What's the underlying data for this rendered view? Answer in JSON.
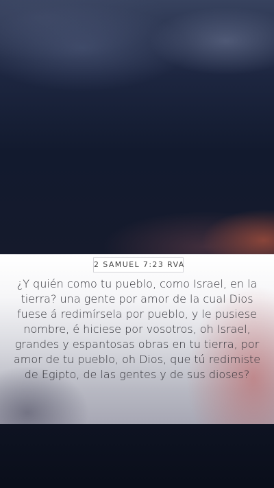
{
  "reference": "2 SAMUEL 7:23 RVA",
  "verse_text": "¿Y quién como tu pueblo, como Israel, en la tierra? una gente por amor de la cual Dios fuese á redimírsela por pueblo, y le pusiese nombre, é hiciese por vosotros, oh Israel, grandes y espantosas obras en tu tierra, por amor de tu pueblo, oh Dios, que tú redimiste de Egipto, de las gentes y de sus dioses?",
  "colors": {
    "sky_top": "#37425e",
    "sky_bottom": "#151a2c",
    "sunset_glow": "#aa503c",
    "text": "#2f2f35",
    "background_bottom": "#0a0e1a"
  }
}
